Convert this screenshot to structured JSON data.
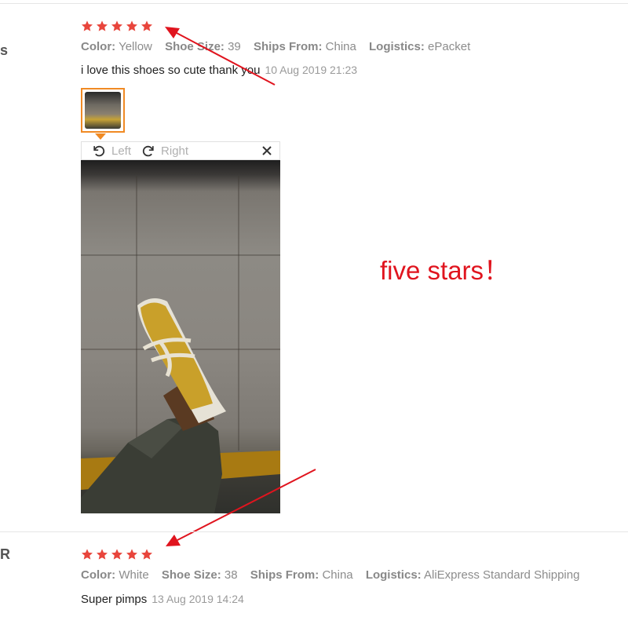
{
  "colors": {
    "star": "#e8453c",
    "accent": "#f08a24",
    "annotation": "#e0141e"
  },
  "reviews": [
    {
      "stars": 5,
      "attributes": [
        {
          "label": "Color:",
          "value": "Yellow"
        },
        {
          "label": "Shoe Size:",
          "value": "39"
        },
        {
          "label": "Ships From:",
          "value": "China"
        },
        {
          "label": "Logistics:",
          "value": "ePacket"
        }
      ],
      "text": "i love this shoes so cute thank you",
      "date": "10 Aug 2019 21:23",
      "edge_glyph": "s"
    },
    {
      "stars": 5,
      "attributes": [
        {
          "label": "Color:",
          "value": "White"
        },
        {
          "label": "Shoe Size:",
          "value": "38"
        },
        {
          "label": "Ships From:",
          "value": "China"
        },
        {
          "label": "Logistics:",
          "value": "AliExpress Standard Shipping"
        }
      ],
      "text": "Super pimps",
      "date": "13 Aug 2019 14:24",
      "edge_glyph": "R"
    }
  ],
  "viewer": {
    "rotate_left_label": "Left",
    "rotate_right_label": "Right",
    "icons": {
      "rotate_left": "rotate-left-icon",
      "rotate_right": "rotate-right-icon",
      "close": "close-icon"
    }
  },
  "annotation": {
    "text": "five stars！"
  }
}
